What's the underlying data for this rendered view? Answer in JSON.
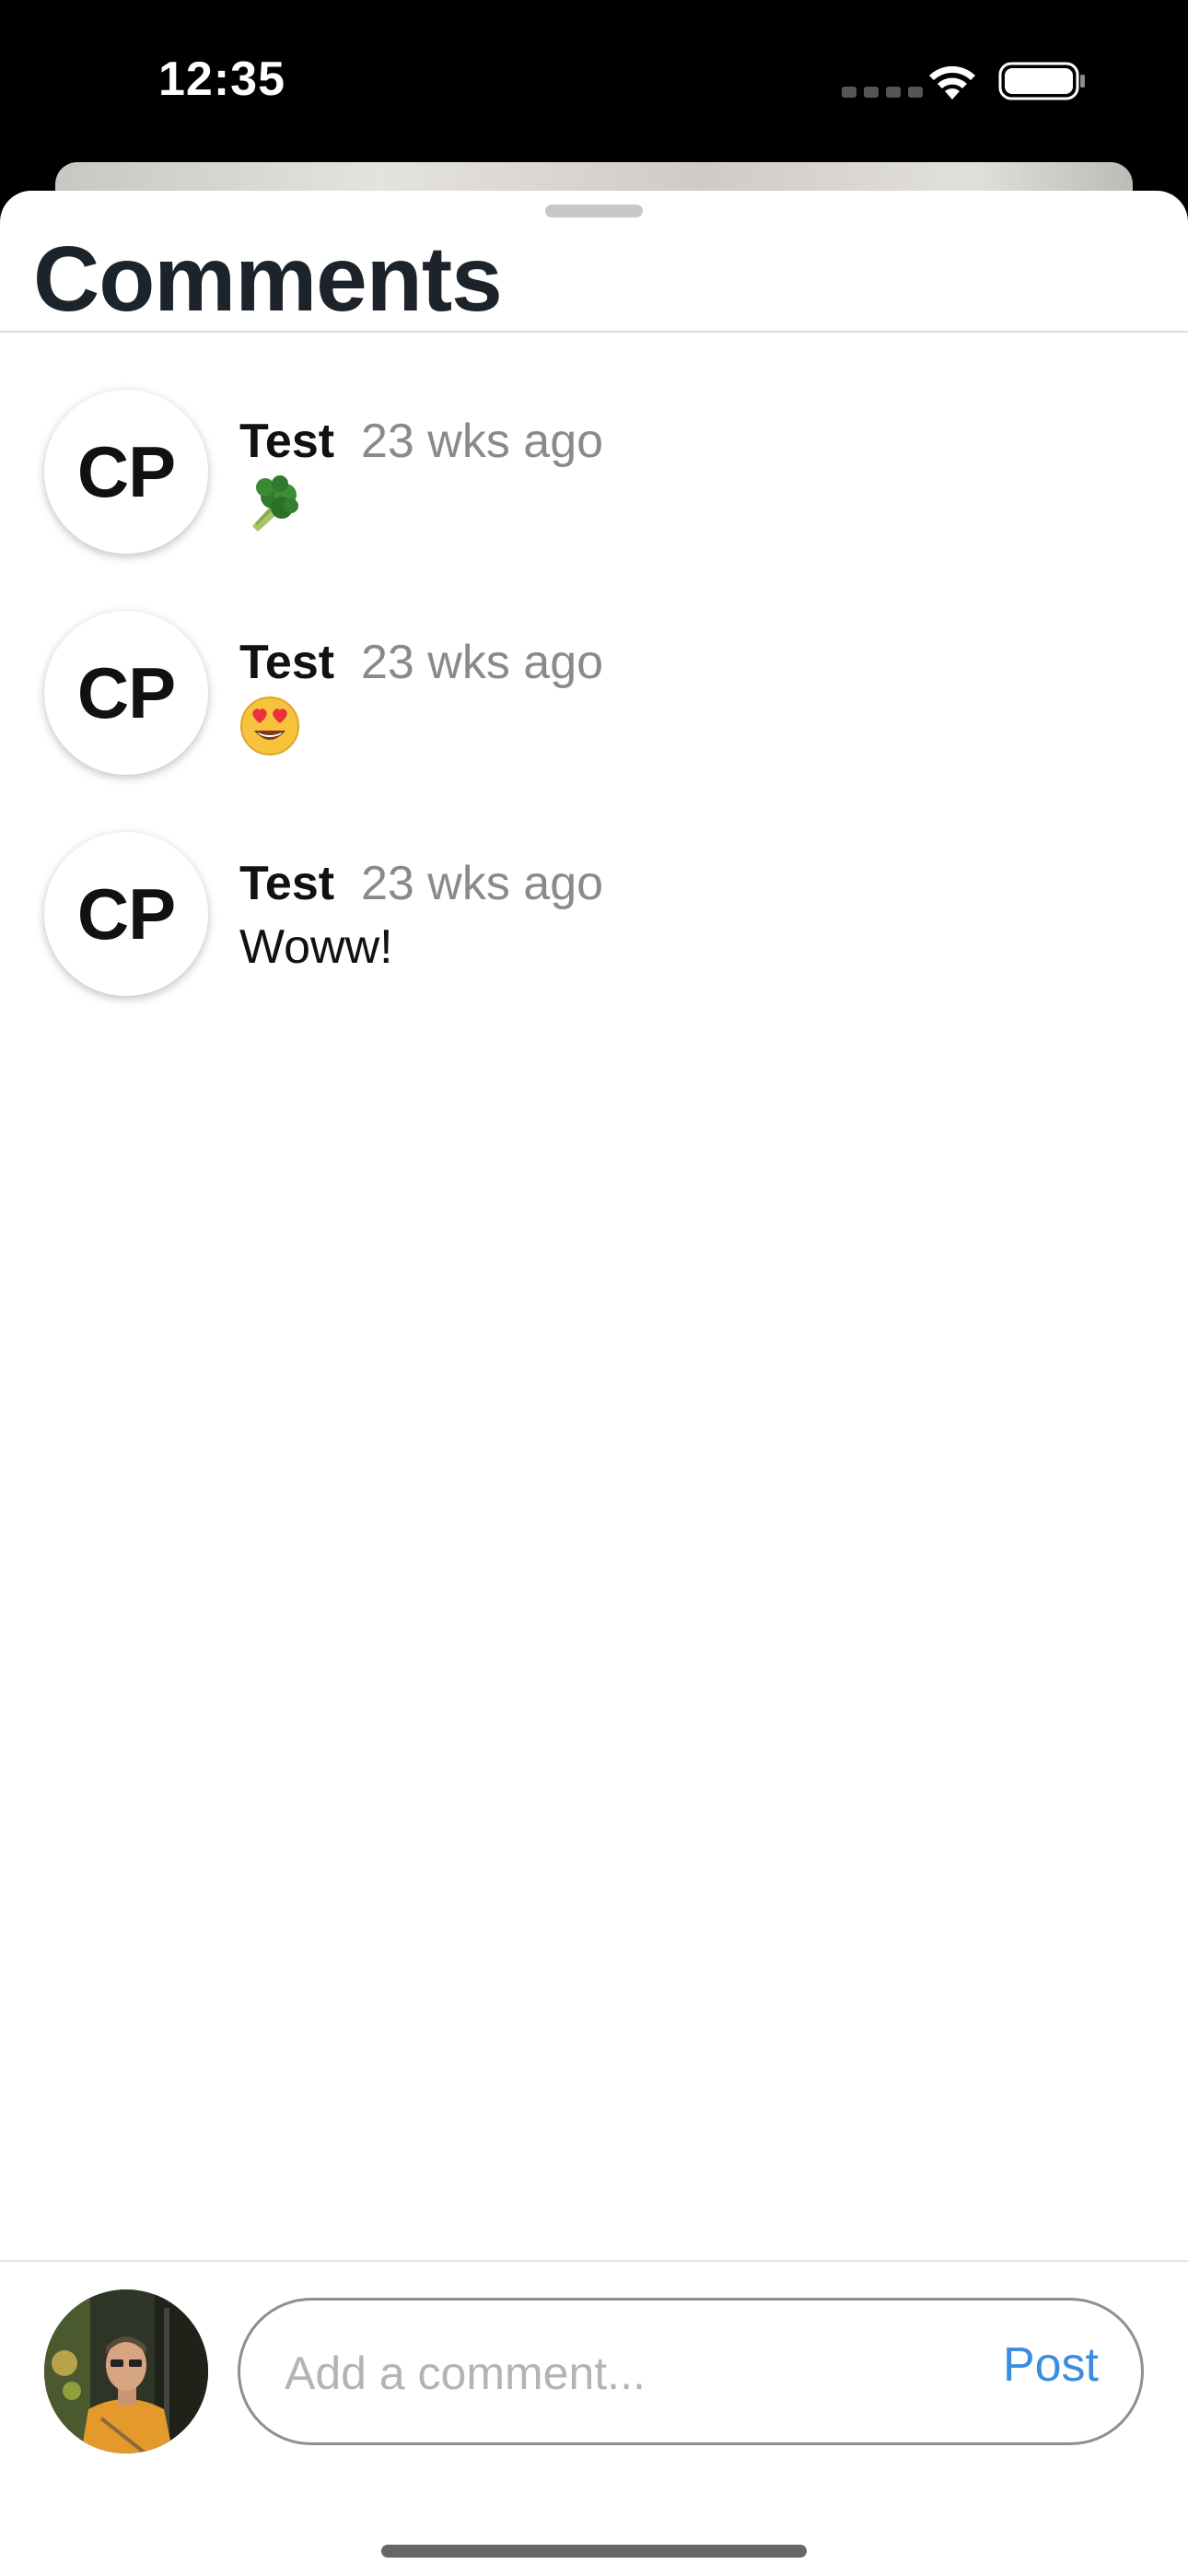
{
  "status_bar": {
    "time": "12:35"
  },
  "sheet": {
    "title": "Comments"
  },
  "comments": [
    {
      "initials": "CP",
      "author": "Test",
      "time": "23 wks ago",
      "body": "",
      "emoji": "broccoli-icon"
    },
    {
      "initials": "CP",
      "author": "Test",
      "time": "23 wks ago",
      "body": "",
      "emoji": "heart-eyes-emoji-icon"
    },
    {
      "initials": "CP",
      "author": "Test",
      "time": "23 wks ago",
      "body": "Woww!"
    }
  ],
  "composer": {
    "placeholder": "Add a comment...",
    "value": "",
    "post_label": "Post",
    "avatar": "user-photo"
  },
  "colors": {
    "accent": "#3c8de0",
    "title": "#1c232b",
    "timestamp": "#8a8a8a"
  }
}
